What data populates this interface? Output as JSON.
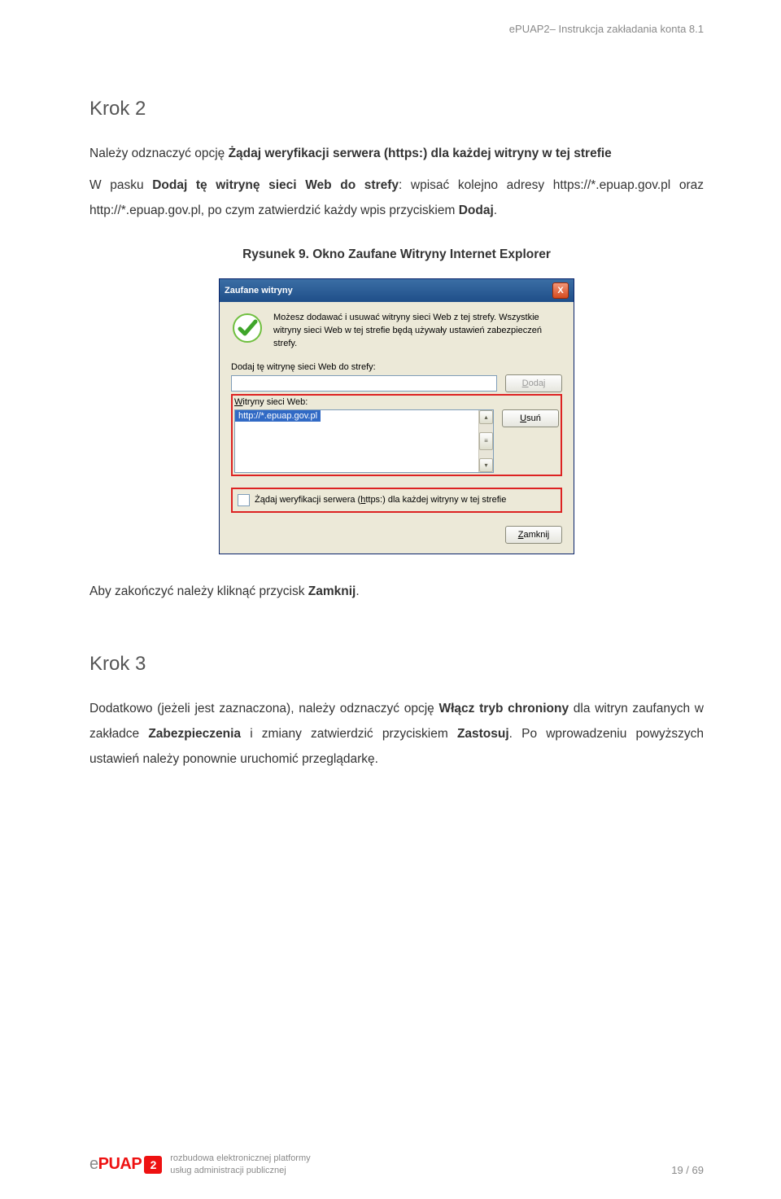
{
  "header": {
    "text": "ePUAP2– Instrukcja zakładania konta 8.1"
  },
  "krok2": {
    "title": "Krok 2",
    "p1a": "Należy odznaczyć opcję ",
    "p1b": "Żądaj weryfikacji serwera (https:) dla każdej witryny w tej strefie",
    "p2a": "W pasku ",
    "p2b": "Dodaj tę witrynę sieci Web do strefy",
    "p2c": ": wpisać kolejno adresy https://*.epuap.gov.pl oraz http://*.epuap.gov.pl, po czym zatwierdzić każdy wpis przyciskiem ",
    "p2d": "Dodaj",
    "p2e": "."
  },
  "caption": "Rysunek 9. Okno Zaufane Witryny Internet Explorer",
  "dialog": {
    "title": "Zaufane witryny",
    "infotext": "Możesz dodawać i usuwać witryny sieci Web z tej strefy. Wszystkie witryny sieci Web w tej strefie będą używały ustawień zabezpieczeń strefy.",
    "add_label_pre": "Dodaj tę witrynę sieci Web do strefy:",
    "add_label_u": "s",
    "add_btn_pre": "D",
    "add_btn_rest": "odaj",
    "list_label_pre": "W",
    "list_label_rest": "itryny sieci Web:",
    "list_item": "http://*.epuap.gov.pl",
    "remove_btn_pre": "U",
    "remove_btn_rest": "suń",
    "checkbox_pre": "Żądaj weryfikacji serwera (",
    "checkbox_u": "h",
    "checkbox_rest": "ttps:) dla każdej witryny w tej strefie",
    "close_btn_pre": "Z",
    "close_btn_rest": "amknij",
    "close_x": "X"
  },
  "after": {
    "a": "Aby zakończyć należy kliknąć przycisk ",
    "b": "Zamknij",
    "c": "."
  },
  "krok3": {
    "title": "Krok 3",
    "a": "Dodatkowo (jeżeli jest zaznaczona), należy odznaczyć opcję ",
    "b": "Włącz tryb chroniony",
    "c": " dla witryn zaufanych w zakładce ",
    "d": "Zabezpieczenia",
    "e": " i zmiany zatwierdzić przyciskiem ",
    "f": "Zastosuj",
    "g": ". Po wprowadzeniu powyższych ustawień należy ponownie uruchomić przeglądarkę."
  },
  "footer": {
    "logo_text": "ePUAP",
    "logo_badge": "2",
    "sub1": "rozbudowa elektronicznej platformy",
    "sub2": "usług administracji publicznej",
    "pagenum": "19 / 69"
  }
}
